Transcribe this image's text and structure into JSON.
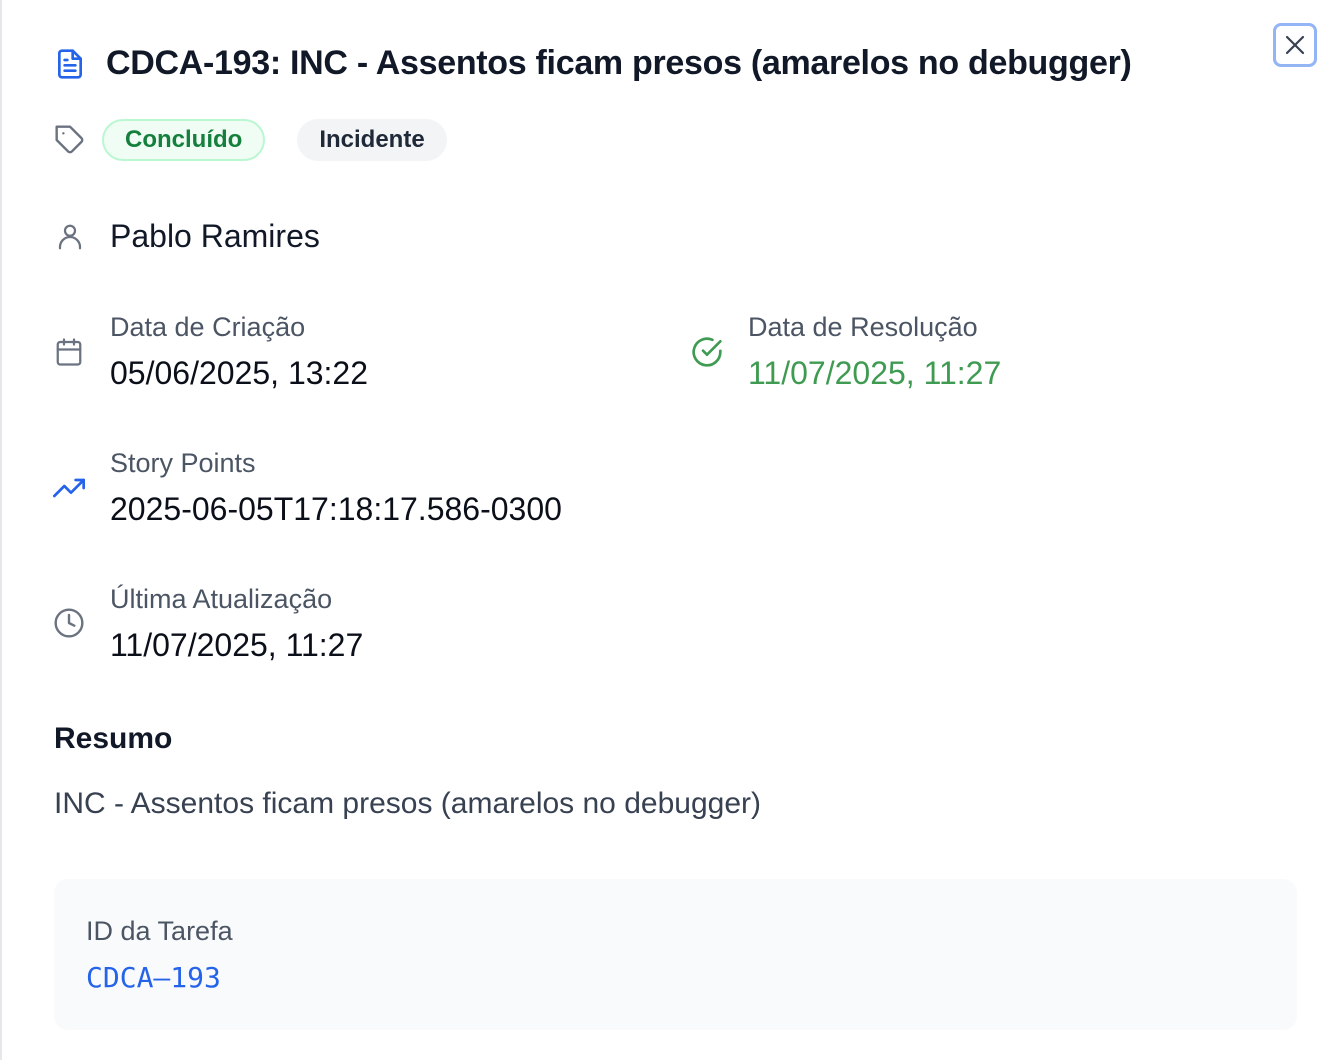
{
  "task": {
    "title": "CDCA-193: INC - Assentos ficam presos (amarelos no debugger)",
    "status_badge": "Concluído",
    "type_badge": "Incidente",
    "assignee": "Pablo Ramires"
  },
  "fields": {
    "created": {
      "label": "Data de Criação",
      "value": "05/06/2025, 13:22"
    },
    "resolved": {
      "label": "Data de Resolução",
      "value": "11/07/2025, 11:27"
    },
    "story_points": {
      "label": "Story Points",
      "value": "2025-06-05T17:18:17.586-0300"
    },
    "updated": {
      "label": "Última Atualização",
      "value": "11/07/2025, 11:27"
    }
  },
  "summary": {
    "heading": "Resumo",
    "text": "INC - Assentos ficam presos (amarelos no debugger)"
  },
  "task_id": {
    "label": "ID da Tarefa",
    "value": "CDCA–193"
  },
  "icons": {
    "title": "file-text-icon",
    "close": "close-icon",
    "tags": "tag-icon",
    "assignee": "user-icon",
    "created": "calendar-icon",
    "resolved": "check-circle-icon",
    "story_points": "trending-up-icon",
    "updated": "clock-icon"
  },
  "colors": {
    "accent_blue": "#2563eb",
    "status_green": "#15803d",
    "resolved_green": "#3f9b52",
    "badge_green_bg": "#f0fdf4",
    "badge_green_border": "#bbf7d0",
    "icon_gray": "#6b7280"
  }
}
